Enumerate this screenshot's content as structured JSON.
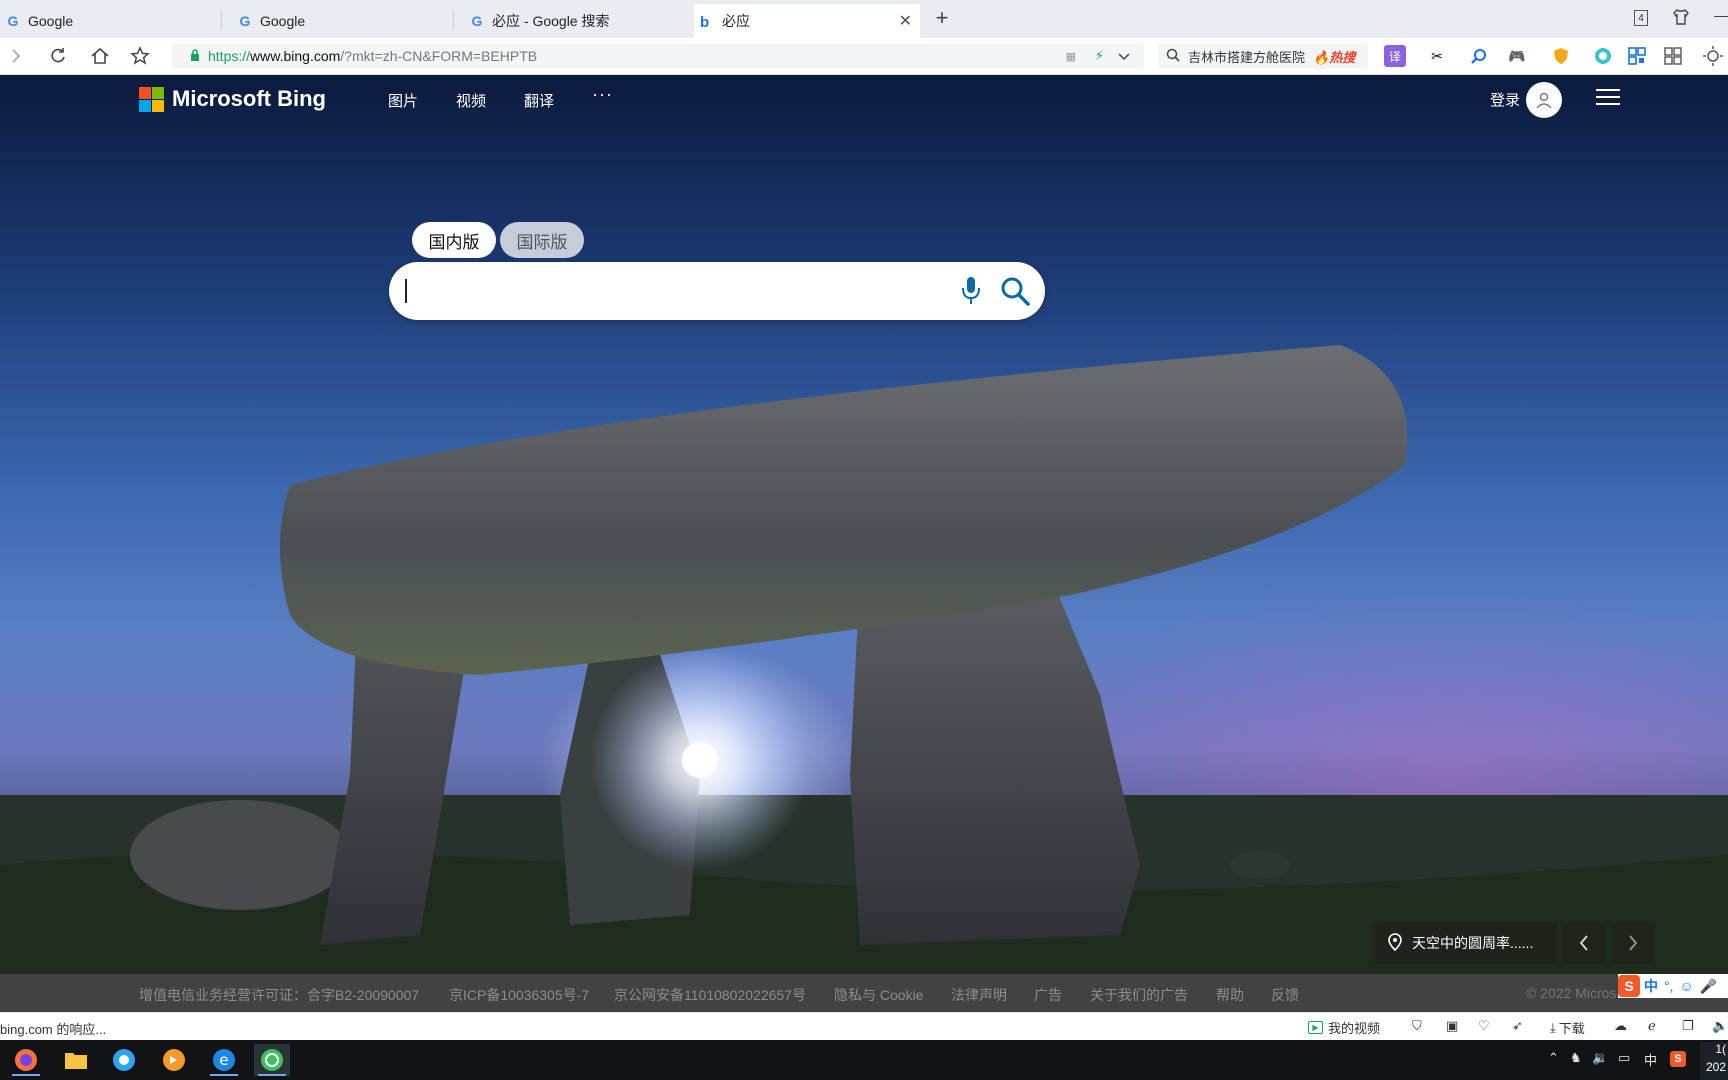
{
  "tabs": [
    {
      "label": "Google",
      "favicon": "G"
    },
    {
      "label": "Google",
      "favicon": "G"
    },
    {
      "label": "必应 - Google 搜索",
      "favicon": "G"
    },
    {
      "label": "必应",
      "favicon": "b"
    }
  ],
  "tab_count_badge": "4",
  "address": {
    "scheme": "https://",
    "domain": "www.bing.com",
    "path": "/?mkt=zh-CN&FORM=BEHPTB"
  },
  "side_search": {
    "text": "吉林市搭建方舱医院",
    "badge": "热搜"
  },
  "toolbar_icons": [
    "translate-icon",
    "scissors-icon",
    "magnifier-icon",
    "gamepad-icon",
    "shield-icon",
    "circle-icon",
    "qrcode-icon",
    "grid-icon",
    "sun-icon"
  ],
  "bing": {
    "logo_text": "Microsoft Bing",
    "nav": [
      "图片",
      "视频",
      "翻译",
      "···"
    ],
    "login_label": "登录",
    "scope_tabs": [
      "国内版",
      "国际版"
    ],
    "caption": "天空中的圆周率......"
  },
  "footer": {
    "links": [
      "增值电信业务经营许可证：合字B2-20090007",
      "京ICP备10036305号-7",
      "京公网安备11010802022657号",
      "隐私与 Cookie",
      "法律声明",
      "广告",
      "关于我们的广告",
      "帮助",
      "反馈"
    ],
    "copyright": "© 2022 Micros"
  },
  "status": {
    "left_text": "bing.com 的响应...",
    "my_video": "我的视频",
    "download": "下载"
  },
  "taskbar": {
    "ime": "中",
    "clock_top": "1(",
    "clock_bottom": "202"
  },
  "ime_bar": {
    "label": "中"
  },
  "colors": {
    "accent_green": "#1aa260",
    "bing_blue": "#1a73e8",
    "hot_red": "#e8452c"
  }
}
